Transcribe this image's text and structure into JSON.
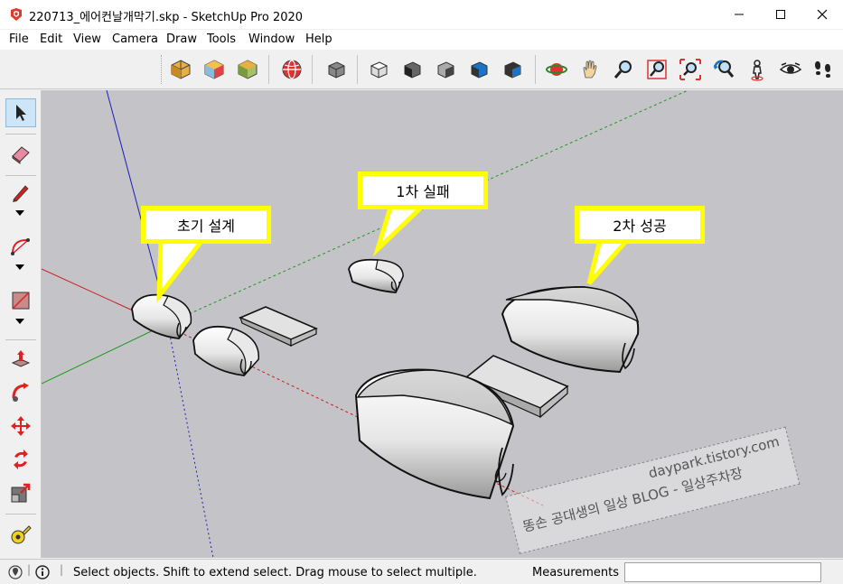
{
  "window": {
    "title": "220713_에어컨날개막기.skp - SketchUp Pro 2020",
    "minimize_icon": "minimize-icon",
    "maximize_icon": "maximize-icon",
    "close_icon": "close-icon"
  },
  "menu": {
    "items": [
      "File",
      "Edit",
      "View",
      "Camera",
      "Draw",
      "Tools",
      "Window",
      "Help"
    ]
  },
  "toolbar": {
    "icons": [
      "extension-warehouse-icon",
      "3d-warehouse-icon",
      "component-library-icon",
      "geo-location-icon",
      "iso-view-icon",
      "top-view-icon",
      "front-view-icon",
      "right-view-icon",
      "back-view-icon",
      "left-view-icon",
      "orbit-icon",
      "pan-icon",
      "zoom-icon",
      "zoom-window-icon",
      "zoom-extents-icon",
      "previous-view-icon",
      "position-camera-icon",
      "look-around-icon",
      "walk-icon"
    ]
  },
  "tools": {
    "items": [
      "select-arrow-icon",
      "eraser-icon",
      "pencil-line-icon",
      "arc-icon",
      "rectangle-icon",
      "push-pull-icon",
      "follow-me-icon",
      "move-icon",
      "rotate-icon",
      "scale-icon",
      "tape-measure-icon"
    ],
    "active": "select-arrow-icon"
  },
  "viewport": {
    "background": "#c4c4c8",
    "callouts": [
      {
        "label": "초기 설계"
      },
      {
        "label": "1차 실패"
      },
      {
        "label": "2차 성공"
      }
    ],
    "callout_color": "#ffff00",
    "axis_colors": {
      "red": "#cc0000",
      "green": "#00aa00",
      "blue": "#0000cc"
    }
  },
  "watermark": {
    "line1": "daypark.tistory.com",
    "line2": "똥손 공대생의 일상 BLOG - 일상주차장"
  },
  "status": {
    "message": "Select objects. Shift to extend select. Drag mouse to select multiple.",
    "measurements_label": "Measurements",
    "measurements_value": ""
  }
}
